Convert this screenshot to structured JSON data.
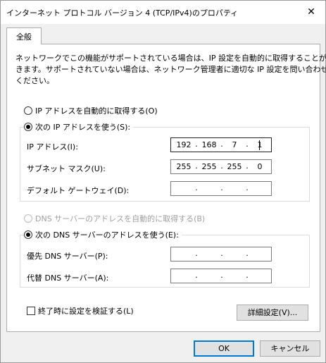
{
  "window": {
    "title": "インターネット プロトコル バージョン 4 (TCP/IPv4)のプロパティ",
    "close_glyph": "✕"
  },
  "tabs": [
    {
      "label": "全般",
      "selected": true
    }
  ],
  "description": {
    "lines": [
      "ネットワークでこの機能がサポートされている場合は、IP 設定を自動的に取得することがで",
      "きます。サポートされていない場合は、ネットワーク管理者に適切な IP 設定を問い合わせて",
      "ください。"
    ]
  },
  "ip_section": {
    "auto_label": "IP アドレスを自動的に取得する(O)",
    "auto_checked": false,
    "manual_label": "次の IP アドレスを使う(S):",
    "manual_checked": true,
    "fields": {
      "ip": {
        "label": "IP アドレス(I):",
        "octets": [
          "192",
          "168",
          "7",
          "1"
        ]
      },
      "subnet": {
        "label": "サブネット マスク(U):",
        "octets": [
          "255",
          "255",
          "255",
          "0"
        ]
      },
      "gateway": {
        "label": "デフォルト ゲートウェイ(D):",
        "octets": [
          "",
          "",
          "",
          ""
        ]
      }
    }
  },
  "dns_section": {
    "auto_label": "DNS サーバーのアドレスを自動的に取得する(B)",
    "auto_checked": false,
    "auto_disabled": true,
    "manual_label": "次の DNS サーバーのアドレスを使う(E):",
    "manual_checked": true,
    "fields": {
      "preferred": {
        "label": "優先 DNS サーバー(P):",
        "octets": [
          "",
          "",
          "",
          ""
        ]
      },
      "alternate": {
        "label": "代替 DNS サーバー(A):",
        "octets": [
          "",
          "",
          "",
          ""
        ]
      }
    }
  },
  "validate_checkbox": {
    "label": "終了時に設定を検証する(L)",
    "checked": false
  },
  "buttons": {
    "advanced": "詳細設定(V)...",
    "ok": "OK",
    "cancel": "キャンセル"
  },
  "ip_separator": "."
}
